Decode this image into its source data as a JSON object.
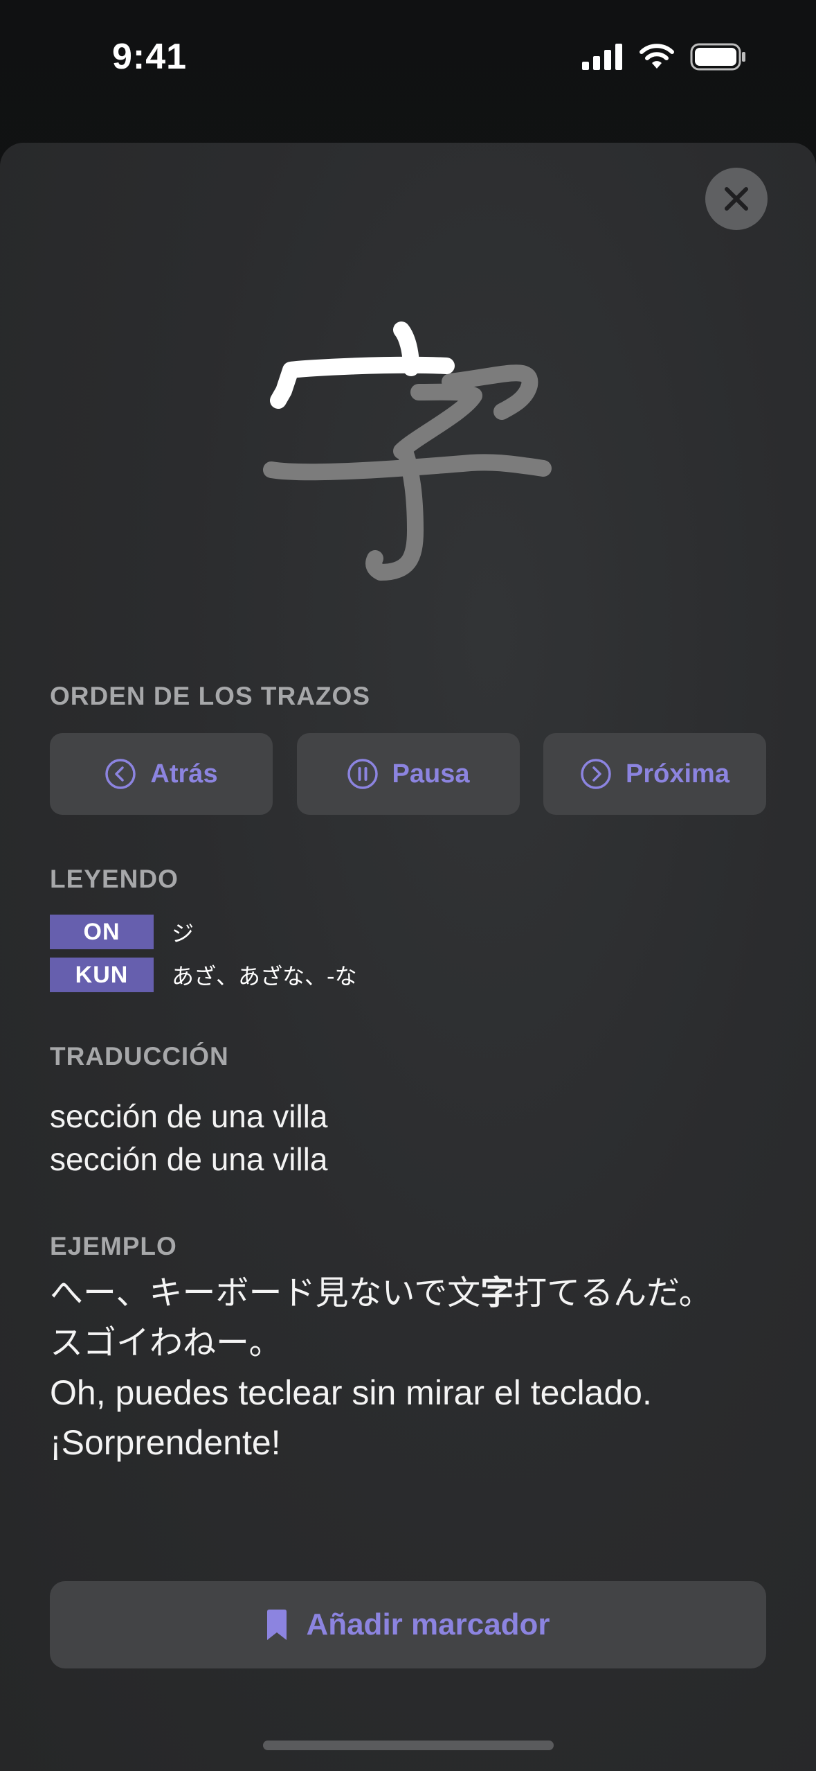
{
  "status_bar": {
    "time": "9:41"
  },
  "kanji": {
    "character": "字"
  },
  "stroke_order": {
    "heading": "ORDEN DE LOS TRAZOS",
    "back_label": "Atrás",
    "pause_label": "Pausa",
    "next_label": "Próxima"
  },
  "readings": {
    "heading": "LEYENDO",
    "items": [
      {
        "type": "ON",
        "value": "ジ"
      },
      {
        "type": "KUN",
        "value": "あざ、あざな、-な"
      }
    ]
  },
  "translation": {
    "heading": "TRADUCCIÓN",
    "lines": [
      "sección de una villa",
      "sección de una villa"
    ]
  },
  "example": {
    "heading": "EJEMPLO",
    "jp_before": "へー、キーボード見ないで文",
    "jp_highlight": "字",
    "jp_after": "打てるんだ。スゴイわねー。",
    "translation": "Oh, puedes teclear sin mirar el teclado. ¡Sorprendente!"
  },
  "bookmark": {
    "label": "Añadir marcador"
  },
  "colors": {
    "accent": "#8c84e0",
    "badge": "#665fae",
    "button_bg": "#434446",
    "stroke_active": "#ffffff",
    "stroke_pending": "#7c7c7c"
  },
  "icons": {
    "close": "close-icon",
    "back": "chevron-left-circle-icon",
    "pause": "pause-circle-icon",
    "next": "chevron-right-circle-icon",
    "bookmark": "bookmark-icon",
    "signal": "cellular-signal-icon",
    "wifi": "wifi-icon",
    "battery": "battery-icon"
  }
}
